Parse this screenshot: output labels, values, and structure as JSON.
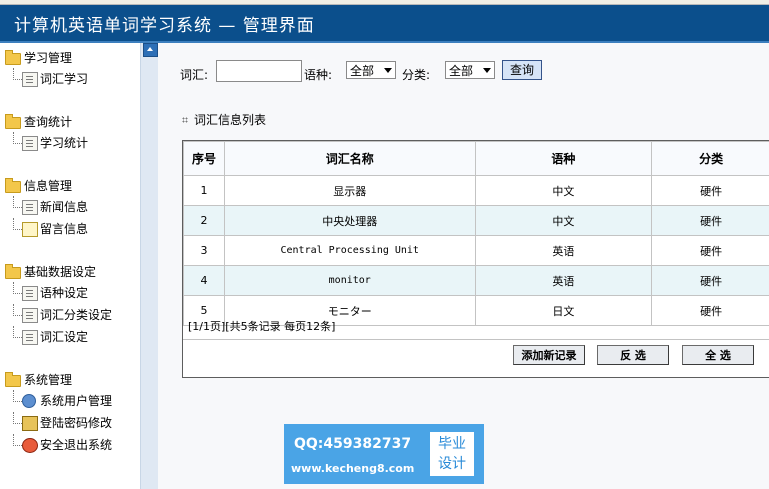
{
  "header": {
    "title": "计算机英语单词学习系统 — 管理界面"
  },
  "sidebar": {
    "groups": [
      {
        "title": "学习管理",
        "items": [
          "词汇学习"
        ]
      },
      {
        "title": "查询统计",
        "items": [
          "学习统计"
        ]
      },
      {
        "title": "信息管理",
        "items": [
          "新闻信息",
          "留言信息"
        ]
      },
      {
        "title": "基础数据设定",
        "items": [
          "语种设定",
          "词汇分类设定",
          "词汇设定"
        ]
      },
      {
        "title": "系统管理",
        "items": [
          "系统用户管理",
          "登陆密码修改",
          "安全退出系统"
        ]
      }
    ]
  },
  "search": {
    "word_label": "词汇:",
    "word_value": "",
    "lang_label": "语种:",
    "lang_selected": "全部",
    "category_label": "分类:",
    "category_selected": "全部",
    "query_button": "查询"
  },
  "list": {
    "title": "词汇信息列表",
    "columns": [
      "序号",
      "词汇名称",
      "语种",
      "分类"
    ],
    "rows": [
      [
        "1",
        "显示器",
        "中文",
        "硬件"
      ],
      [
        "2",
        "中央处理器",
        "中文",
        "硬件"
      ],
      [
        "3",
        "Central Processing Unit",
        "英语",
        "硬件"
      ],
      [
        "4",
        "monitor",
        "英语",
        "硬件"
      ],
      [
        "5",
        "モニター",
        "日文",
        "硬件"
      ]
    ],
    "pager": "[1/1页][共5条记录 每页12条]",
    "buttons": {
      "add": "添加新记录",
      "invert": "反 选",
      "select_all": "全 选"
    }
  },
  "watermark": {
    "qq": "QQ:459382737",
    "site": "www.kecheng8.com",
    "badge_line1": "毕业",
    "badge_line2": "设计"
  }
}
